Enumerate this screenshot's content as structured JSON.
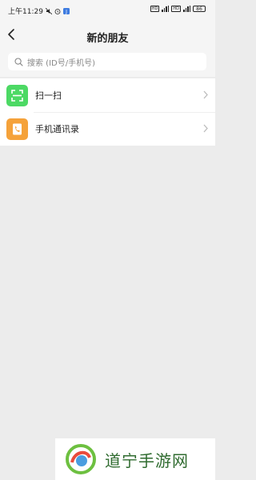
{
  "statusbar": {
    "time": "上午11:29",
    "network_badge": "5G",
    "battery": "86"
  },
  "navbar": {
    "title": "新的朋友"
  },
  "search": {
    "placeholder": "搜索 (ID号/手机号)"
  },
  "list": [
    {
      "label": "扫一扫",
      "icon": "scan-icon",
      "color": "#4cd964"
    },
    {
      "label": "手机通讯录",
      "icon": "contacts-icon",
      "color": "#f5a23a"
    }
  ],
  "watermark": {
    "text": "道宁手游网"
  }
}
